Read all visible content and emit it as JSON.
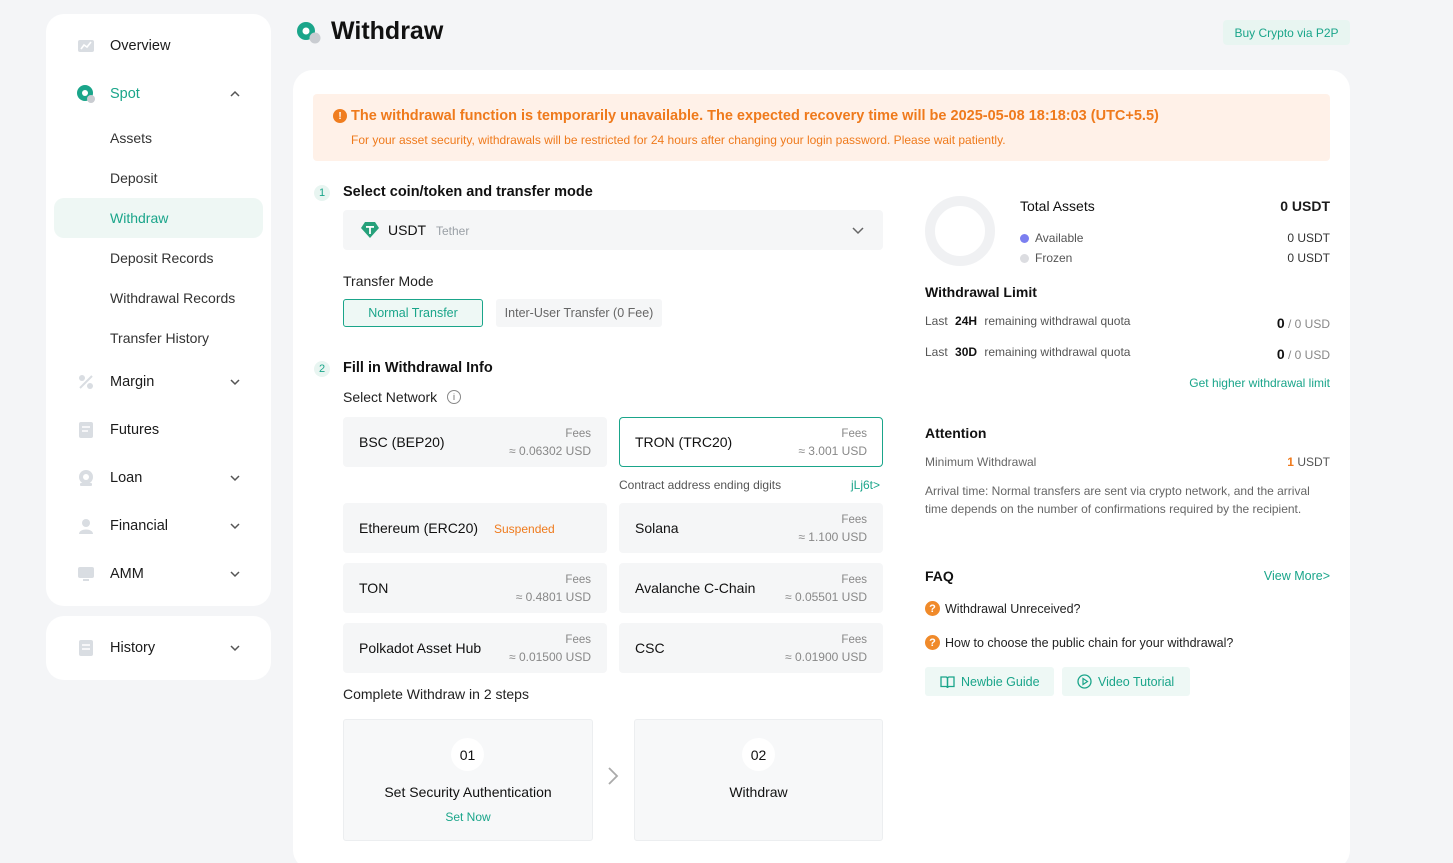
{
  "sidebar": {
    "items": [
      {
        "label": "Overview",
        "icon": "chart-board-icon"
      },
      {
        "label": "Spot",
        "icon": "spot-coin-icon"
      },
      {
        "label": "Margin",
        "icon": "percent-icon"
      },
      {
        "label": "Futures",
        "icon": "document-icon"
      },
      {
        "label": "Loan",
        "icon": "coin-loan-icon"
      },
      {
        "label": "Financial",
        "icon": "finance-person-icon"
      },
      {
        "label": "AMM",
        "icon": "monitor-icon"
      }
    ],
    "spot_sub": [
      "Assets",
      "Deposit",
      "Withdraw",
      "Deposit Records",
      "Withdrawal Records",
      "Transfer History"
    ],
    "history": "History",
    "accent": "#1aa58a"
  },
  "header": {
    "title": "Withdraw",
    "p2p_button": "Buy Crypto via P2P"
  },
  "alert": {
    "title": "The withdrawal function is temporarily unavailable. The expected recovery time will be 2025-05-08 18:18:03 (UTC+5.5)",
    "subtitle": "For your asset security, withdrawals will be restricted for 24 hours after changing your login password. Please wait patiently.",
    "icon": "!",
    "color": "#ef7a1c"
  },
  "step1": {
    "num": "1",
    "title": "Select coin/token and transfer mode",
    "coin_symbol": "USDT",
    "coin_name": "Tether",
    "transfer_mode_label": "Transfer Mode",
    "mode_normal": "Normal Transfer",
    "mode_inter": "Inter-User Transfer (0 Fee)"
  },
  "step2": {
    "num": "2",
    "title": "Fill in Withdrawal Info",
    "select_network": "Select Network",
    "info_glyph": "i",
    "fees_label": "Fees",
    "networks": [
      {
        "name": "BSC (BEP20)",
        "fee": "≈ 0.06302 USD"
      },
      {
        "name": "TRON (TRC20)",
        "fee": "≈ 3.001 USD"
      },
      {
        "name": "Ethereum (ERC20)",
        "status": "Suspended"
      },
      {
        "name": "Solana",
        "fee": "≈ 1.100 USD"
      },
      {
        "name": "TON",
        "fee": "≈ 0.4801 USD"
      },
      {
        "name": "Avalanche C-Chain",
        "fee": "≈ 0.05501 USD"
      },
      {
        "name": "Polkadot Asset Hub",
        "fee": "≈ 0.01500 USD"
      },
      {
        "name": "CSC",
        "fee": "≈ 0.01900 USD"
      }
    ],
    "contract_label": "Contract address ending digits",
    "contract_value": "jLj6t>",
    "complete_label": "Complete Withdraw in 2 steps",
    "steps": [
      {
        "num": "01",
        "title": "Set Security Authentication",
        "link": "Set Now"
      },
      {
        "num": "02",
        "title": "Withdraw"
      }
    ]
  },
  "assets": {
    "total_label": "Total Assets",
    "total_value": "0 USDT",
    "available_label": "Available",
    "available_value": "0 USDT",
    "frozen_label": "Frozen",
    "frozen_value": "0 USDT",
    "available_color": "#7b7ff0",
    "frozen_color": "#dcdde1"
  },
  "limit": {
    "title": "Withdrawal Limit",
    "rows": [
      {
        "prefix": "Last",
        "period": "24H",
        "suffix": "remaining withdrawal quota",
        "value": "0",
        "unit": "/ 0 USD"
      },
      {
        "prefix": "Last",
        "period": "30D",
        "suffix": "remaining withdrawal quota",
        "value": "0",
        "unit": "/ 0 USD"
      }
    ],
    "link": "Get higher withdrawal limit"
  },
  "attention": {
    "title": "Attention",
    "min_label": "Minimum Withdrawal",
    "min_value": "1",
    "min_unit": "USDT",
    "arrival": "Arrival time: Normal transfers are sent via crypto network, and the arrival time depends on the number of confirmations required by the recipient."
  },
  "faq": {
    "title": "FAQ",
    "more": "View More>",
    "icon": "?",
    "questions": [
      "Withdrawal Unreceived?",
      "How to choose the public chain for your withdrawal?"
    ],
    "newbie": "Newbie Guide",
    "video": "Video Tutorial"
  }
}
